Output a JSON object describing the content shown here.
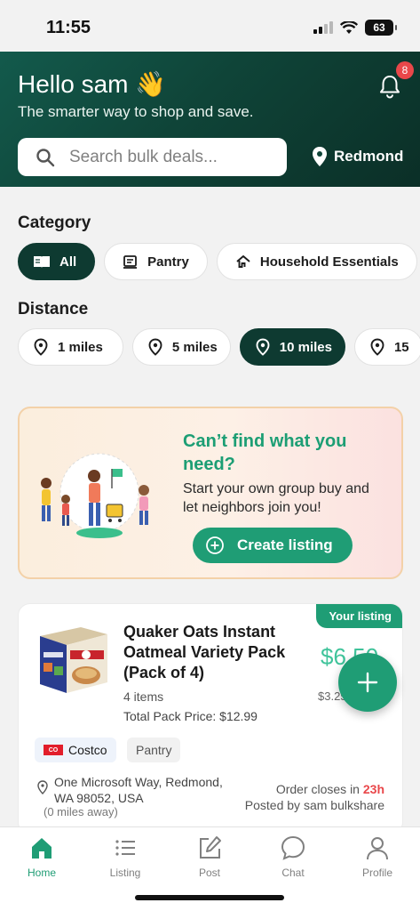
{
  "status_bar": {
    "time": "11:55",
    "battery": "63"
  },
  "header": {
    "greeting": "Hello sam 👋",
    "tagline": "The smarter way to shop and save.",
    "notification_count": "8",
    "search_placeholder": "Search bulk deals...",
    "location": "Redmond"
  },
  "category": {
    "title": "Category",
    "chips": [
      {
        "label": "All",
        "icon": "book-icon",
        "active": true
      },
      {
        "label": "Pantry",
        "icon": "pantry-icon",
        "active": false
      },
      {
        "label": "Household Essentials",
        "icon": "house-icon",
        "active": false
      }
    ]
  },
  "distance": {
    "title": "Distance",
    "chips": [
      {
        "label": "1 miles",
        "active": false
      },
      {
        "label": "5 miles",
        "active": false
      },
      {
        "label": "10 miles",
        "active": true
      },
      {
        "label": "15",
        "active": false
      }
    ]
  },
  "promo": {
    "title": "Can’t find what you need?",
    "text": "Start your own group buy and let neighbors join you!",
    "button_label": "Create listing"
  },
  "listing": {
    "tag": "Your listing",
    "title": "Quaker Oats Instant Oatmeal Variety Pack (Pack of 4)",
    "items": "4 items",
    "total_price": "Total Pack Price: $12.99",
    "price": "$6.50",
    "unit_price": "$3.25",
    "store": "Costco",
    "category": "Pantry",
    "address": "One Microsoft Way, Redmond, WA 98052, USA",
    "distance_note": "(0 miles away)",
    "closes_label": "Order closes in",
    "closes_time": "23h",
    "posted_by": "Posted by sam bulkshare"
  },
  "tabs": [
    {
      "label": "Home",
      "icon": "home-icon",
      "active": true
    },
    {
      "label": "Listing",
      "icon": "list-icon",
      "active": false
    },
    {
      "label": "Post",
      "icon": "edit-icon",
      "active": false
    },
    {
      "label": "Chat",
      "icon": "chat-icon",
      "active": false
    },
    {
      "label": "Profile",
      "icon": "profile-icon",
      "active": false
    }
  ],
  "colors": {
    "brand_green": "#1f9d75",
    "header_dark": "#0e3a31",
    "accent_red": "#e9474a"
  }
}
